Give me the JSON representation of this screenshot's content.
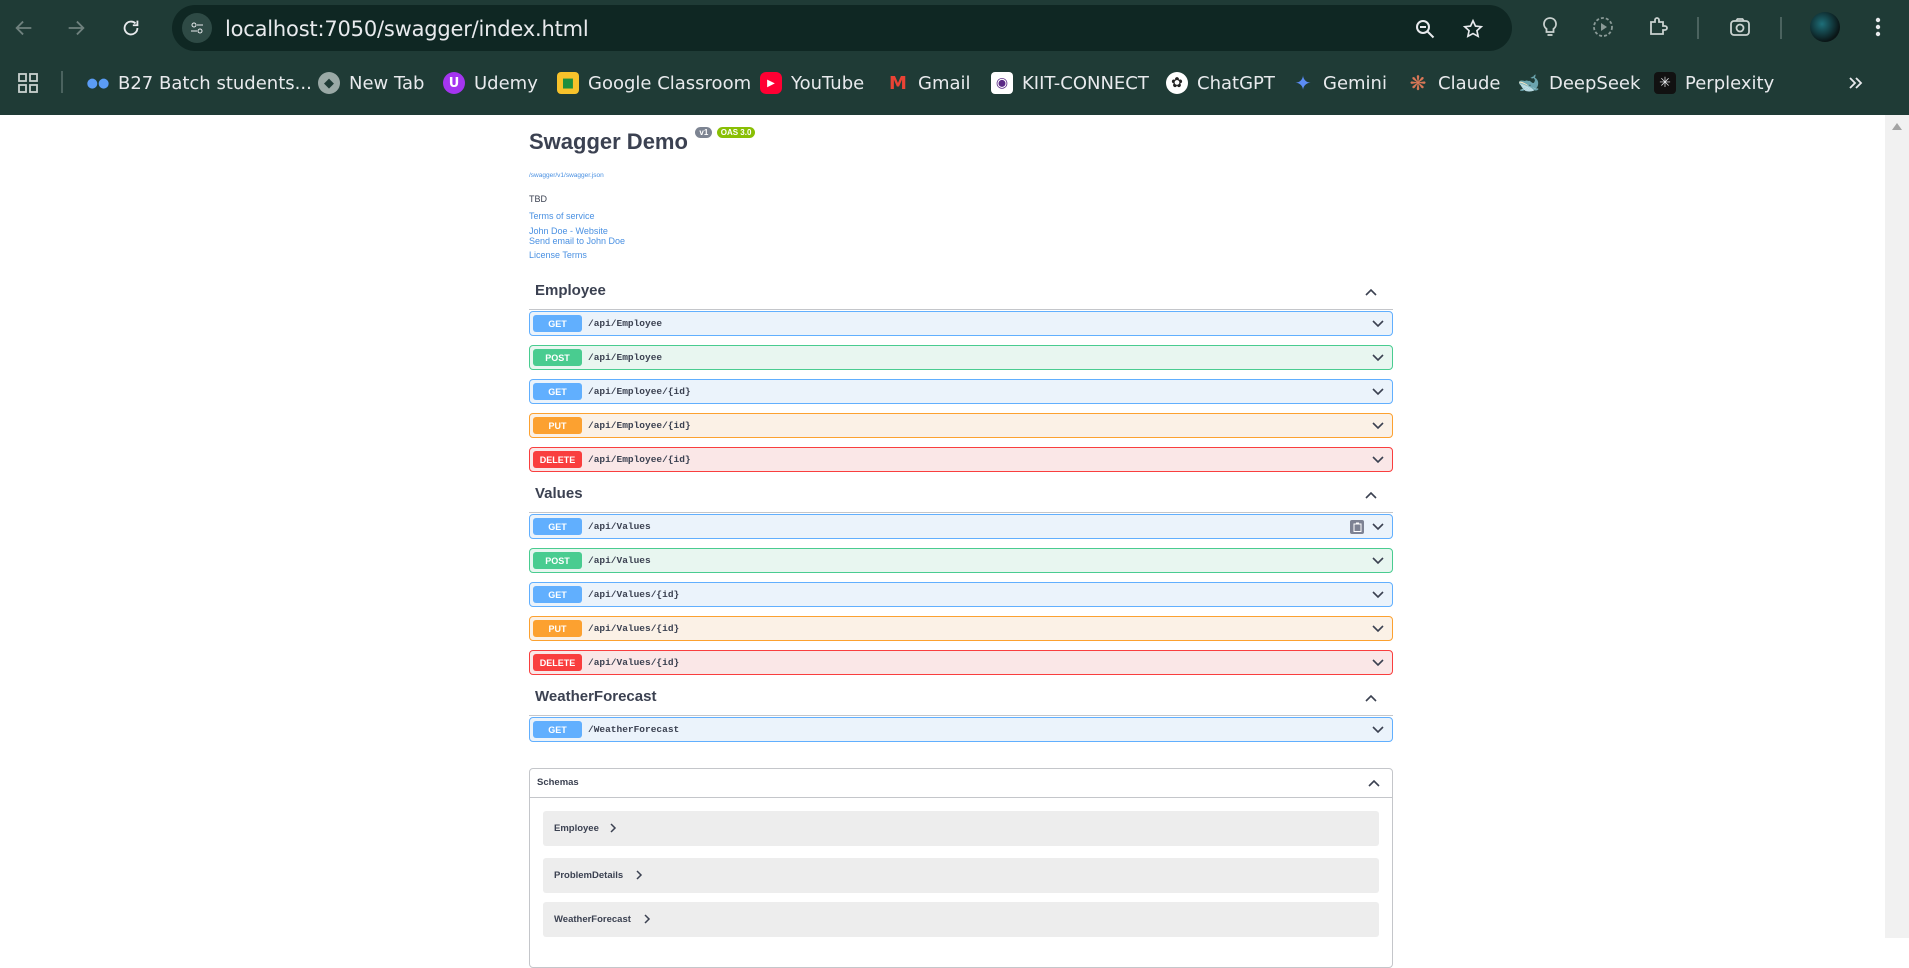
{
  "browser": {
    "url": "localhost:7050/swagger/index.html",
    "bookmarks": [
      {
        "label": "B27 Batch students...",
        "icon": "people-icon"
      },
      {
        "label": "New Tab",
        "icon": "globe-icon"
      },
      {
        "label": "Udemy",
        "icon": "udemy-icon"
      },
      {
        "label": "Google Classroom",
        "icon": "classroom-icon"
      },
      {
        "label": "YouTube",
        "icon": "youtube-icon"
      },
      {
        "label": "Gmail",
        "icon": "gmail-icon"
      },
      {
        "label": "KIIT-CONNECT",
        "icon": "kiit-icon"
      },
      {
        "label": "ChatGPT",
        "icon": "chatgpt-icon"
      },
      {
        "label": "Gemini",
        "icon": "gemini-icon"
      },
      {
        "label": "Claude",
        "icon": "claude-icon"
      },
      {
        "label": "DeepSeek",
        "icon": "deepseek-icon"
      },
      {
        "label": "Perplexity",
        "icon": "perplexity-icon"
      }
    ]
  },
  "info": {
    "title": "Swagger Demo",
    "version": "v1",
    "oas": "OAS 3.0",
    "spec_url": "/swagger/v1/swagger.json",
    "description": "TBD",
    "terms": "Terms of service",
    "contact_website": "John Doe - Website",
    "contact_email": "Send email to John Doe",
    "license": "License Terms"
  },
  "tags": [
    {
      "name": "Employee",
      "operations": [
        {
          "method": "GET",
          "path": "/api/Employee"
        },
        {
          "method": "POST",
          "path": "/api/Employee"
        },
        {
          "method": "GET",
          "path": "/api/Employee/{id}"
        },
        {
          "method": "PUT",
          "path": "/api/Employee/{id}"
        },
        {
          "method": "DELETE",
          "path": "/api/Employee/{id}"
        }
      ]
    },
    {
      "name": "Values",
      "operations": [
        {
          "method": "GET",
          "path": "/api/Values"
        },
        {
          "method": "POST",
          "path": "/api/Values"
        },
        {
          "method": "GET",
          "path": "/api/Values/{id}"
        },
        {
          "method": "PUT",
          "path": "/api/Values/{id}"
        },
        {
          "method": "DELETE",
          "path": "/api/Values/{id}"
        }
      ]
    },
    {
      "name": "WeatherForecast",
      "operations": [
        {
          "method": "GET",
          "path": "/WeatherForecast"
        }
      ]
    }
  ],
  "schemas": {
    "title": "Schemas",
    "models": [
      "Employee",
      "ProblemDetails",
      "WeatherForecast"
    ]
  },
  "colors": {
    "get": "#61affe",
    "post": "#49cc90",
    "put": "#fca130",
    "delete": "#f93e3e",
    "chrome_bg": "#1f3b36"
  }
}
